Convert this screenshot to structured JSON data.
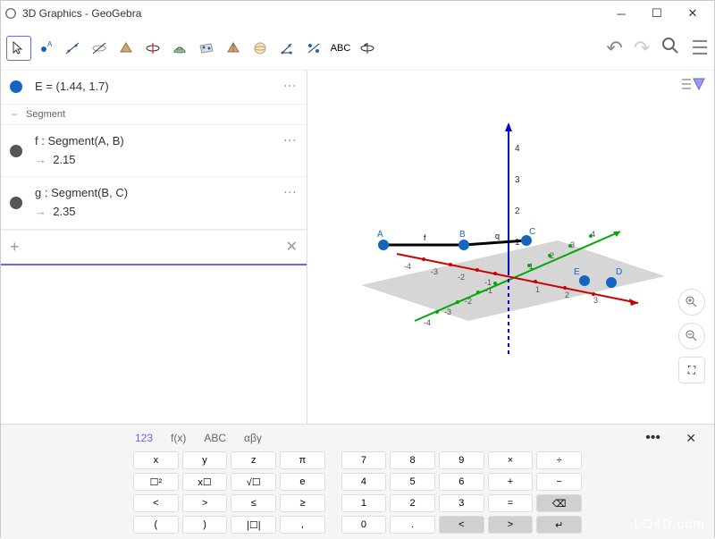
{
  "window": {
    "title": "3D Graphics - GeoGebra"
  },
  "toolbar": {
    "abc_label": "ABC"
  },
  "algebra": {
    "E_label": "E = (1.44, 1.7)",
    "section_header": "Segment",
    "f_label": "f : Segment(A, B)",
    "f_value": "2.15",
    "g_label": "g : Segment(B, C)",
    "g_value": "2.35"
  },
  "scene": {
    "points": {
      "A": "A",
      "B": "B",
      "C": "C",
      "D": "D",
      "E": "E"
    },
    "segment_labels": {
      "f": "f",
      "q": "q"
    },
    "x_ticks": [
      "-4",
      "-3",
      "-2",
      "-1",
      "1",
      "2",
      "3"
    ],
    "y_ticks": [
      "-4",
      "-3",
      "-2",
      "-1",
      "1",
      "2",
      "3",
      "4"
    ],
    "z_ticks": [
      "1",
      "2",
      "3",
      "4"
    ]
  },
  "keyboard": {
    "tabs": {
      "t1": "123",
      "t2": "f(x)",
      "t3": "ABC",
      "t4": "αβγ"
    },
    "r1": {
      "k1": "x",
      "k2": "y",
      "k3": "z",
      "k4": "π",
      "k5": "7",
      "k6": "8",
      "k7": "9",
      "k8": "×",
      "k9": "÷"
    },
    "r2": {
      "k1": "☐²",
      "k2": "x☐",
      "k3": "√☐",
      "k4": "e",
      "k5": "4",
      "k6": "5",
      "k7": "6",
      "k8": "+",
      "k9": "−"
    },
    "r3": {
      "k1": "<",
      "k2": ">",
      "k3": "≤",
      "k4": "≥",
      "k5": "1",
      "k6": "2",
      "k7": "3",
      "k8": "=",
      "k9": "⌫"
    },
    "r4": {
      "k1": "(",
      "k2": ")",
      "k3": "|☐|",
      "k4": ",",
      "k5": "0",
      "k6": ".",
      "k7": "<",
      "k8": ">",
      "k9": "↵"
    }
  },
  "watermark": "LO4D.com"
}
